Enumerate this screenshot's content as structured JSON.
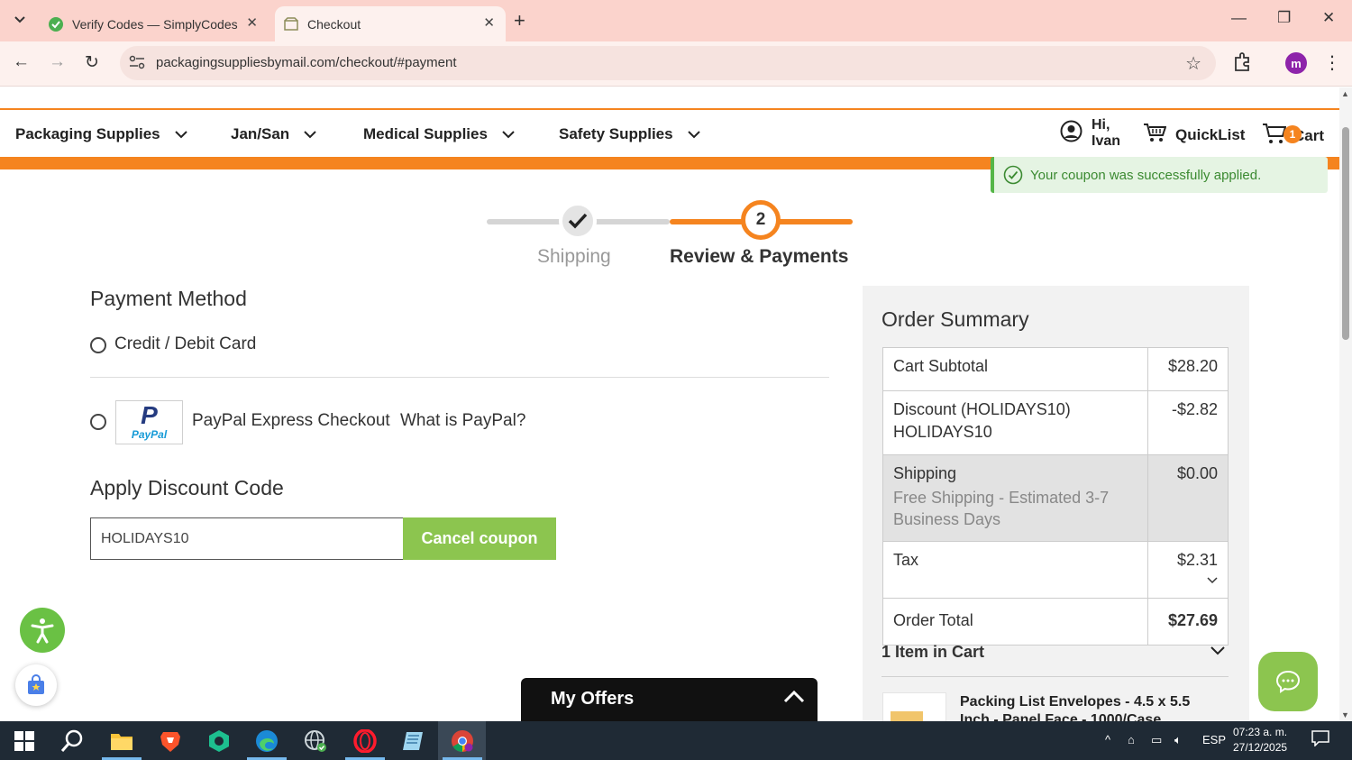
{
  "browser": {
    "tabs": [
      {
        "title": "Verify Codes — SimplyCodes",
        "active": false
      },
      {
        "title": "Checkout",
        "active": true
      }
    ],
    "url": "packagingsuppliesbymail.com/checkout/#payment",
    "profile_initial": "m"
  },
  "nav": {
    "items": [
      "Packaging Supplies",
      "Jan/San",
      "Medical Supplies",
      "Safety Supplies"
    ],
    "greeting_line1": "Hi,",
    "greeting_line2": "Ivan",
    "quicklist": "QuickList",
    "cart": "Cart",
    "cart_count": "1"
  },
  "toast": "Your coupon was successfully applied.",
  "stepper": {
    "step1": "Shipping",
    "step2_number": "2",
    "step2": "Review & Payments"
  },
  "payment": {
    "heading": "Payment Method",
    "option_card": "Credit / Debit Card",
    "paypal_logo_p": "P",
    "paypal_logo_text": "PayPal",
    "option_paypal": "PayPal Express Checkout",
    "what_is_paypal": "What is PayPal?"
  },
  "discount": {
    "heading": "Apply Discount Code",
    "code_value": "HOLIDAYS10",
    "cancel_label": "Cancel coupon"
  },
  "summary": {
    "title": "Order Summary",
    "subtotal_label": "Cart Subtotal",
    "subtotal_value": "$28.20",
    "discount_label": "Discount (HOLIDAYS10)",
    "discount_code": "HOLIDAYS10",
    "discount_value": "-$2.82",
    "shipping_label": "Shipping",
    "shipping_detail": "Free Shipping - Estimated 3-7 Business Days",
    "shipping_value": "$0.00",
    "tax_label": "Tax",
    "tax_value": "$2.31",
    "total_label": "Order Total",
    "total_value": "$27.69",
    "items_label": "1 Item in Cart",
    "product_name": "Packing List Envelopes - 4.5 x 5.5 Inch - Panel Face - 1000/Case"
  },
  "offers": {
    "title": "My Offers"
  },
  "taskbar": {
    "language": "ESP",
    "time": "07:23 a. m.",
    "date": "27/12/2025"
  },
  "colors": {
    "accent_orange": "#f5841f",
    "button_green": "#8cc54f",
    "success_green": "#55b648",
    "tabstrip": "#fbd3cc"
  }
}
